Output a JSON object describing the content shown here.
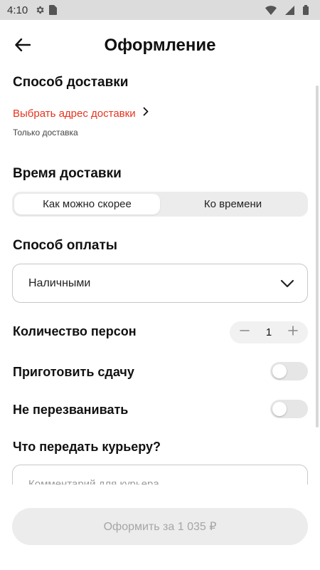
{
  "statusbar": {
    "time": "4:10"
  },
  "header": {
    "title": "Оформление"
  },
  "delivery": {
    "title": "Способ доставки",
    "address_link": "Выбрать адрес доставки",
    "note": "Только доставка"
  },
  "delivery_time": {
    "title": "Время доставки",
    "options": [
      "Как можно скорее",
      "Ко времени"
    ],
    "selected_index": 0
  },
  "payment": {
    "title": "Способ оплаты",
    "selected": "Наличными"
  },
  "persons": {
    "label": "Количество персон",
    "count": "1"
  },
  "change": {
    "label": "Приготовить сдачу",
    "on": false
  },
  "no_call": {
    "label": "Не перезванивать",
    "on": false
  },
  "courier": {
    "title": "Что передать курьеру?",
    "placeholder": "Комментарий для курьера"
  },
  "submit": {
    "label": "Оформить за 1 035 ₽"
  },
  "colors": {
    "accent_red": "#e5341f",
    "disabled_bg": "#ececec",
    "disabled_text": "#a6a6a6"
  }
}
